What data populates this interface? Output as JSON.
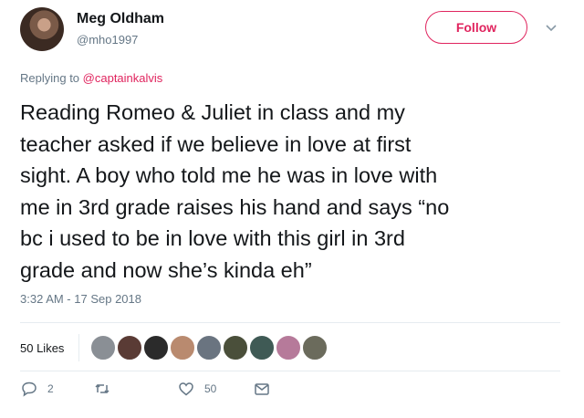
{
  "author": {
    "name": "Meg Oldham",
    "handle": "@mho1997",
    "follow_label": "Follow"
  },
  "reply": {
    "prefix": "Replying to ",
    "to": "@captainkalvis"
  },
  "tweet_lines": [
    "Reading Romeo & Juliet in class and my",
    "teacher asked if we believe in love at first",
    "sight. A boy who told me he was in love with",
    "me in 3rd grade raises his hand and says “no",
    "bc i used to be in love with this girl in 3rd",
    "grade and now she’s kinda eh”"
  ],
  "timestamp": "3:32 AM - 17 Sep 2018",
  "likes": {
    "label": "50 Likes",
    "liker_colors": [
      "#8a8f95",
      "#5a3b35",
      "#2b2b2b",
      "#b98a6f",
      "#6a7480",
      "#4a4f3a",
      "#3f5a55",
      "#b67a9a",
      "#6b6b5c"
    ]
  },
  "actions": {
    "reply_count": "2",
    "retweet_count": "",
    "like_count": "50"
  },
  "colors": {
    "accent": "#e0245e",
    "muted": "#657786",
    "divider": "#e6ecf0"
  }
}
